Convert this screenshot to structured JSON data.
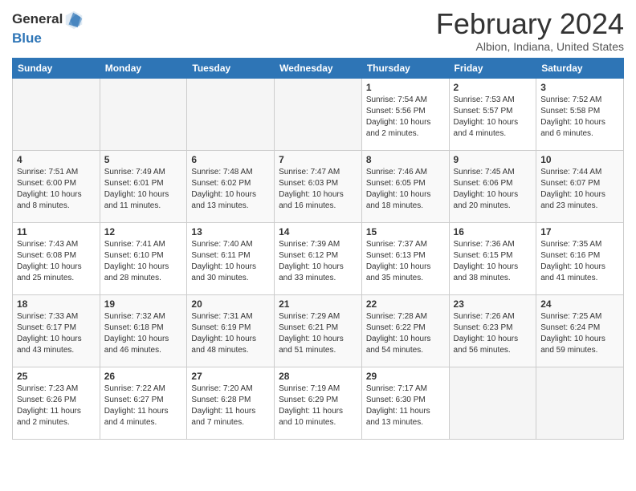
{
  "header": {
    "logo_general": "General",
    "logo_blue": "Blue",
    "title": "February 2024",
    "subtitle": "Albion, Indiana, United States"
  },
  "days_of_week": [
    "Sunday",
    "Monday",
    "Tuesday",
    "Wednesday",
    "Thursday",
    "Friday",
    "Saturday"
  ],
  "weeks": [
    [
      {
        "day": "",
        "info": ""
      },
      {
        "day": "",
        "info": ""
      },
      {
        "day": "",
        "info": ""
      },
      {
        "day": "",
        "info": ""
      },
      {
        "day": "1",
        "info": "Sunrise: 7:54 AM\nSunset: 5:56 PM\nDaylight: 10 hours\nand 2 minutes."
      },
      {
        "day": "2",
        "info": "Sunrise: 7:53 AM\nSunset: 5:57 PM\nDaylight: 10 hours\nand 4 minutes."
      },
      {
        "day": "3",
        "info": "Sunrise: 7:52 AM\nSunset: 5:58 PM\nDaylight: 10 hours\nand 6 minutes."
      }
    ],
    [
      {
        "day": "4",
        "info": "Sunrise: 7:51 AM\nSunset: 6:00 PM\nDaylight: 10 hours\nand 8 minutes."
      },
      {
        "day": "5",
        "info": "Sunrise: 7:49 AM\nSunset: 6:01 PM\nDaylight: 10 hours\nand 11 minutes."
      },
      {
        "day": "6",
        "info": "Sunrise: 7:48 AM\nSunset: 6:02 PM\nDaylight: 10 hours\nand 13 minutes."
      },
      {
        "day": "7",
        "info": "Sunrise: 7:47 AM\nSunset: 6:03 PM\nDaylight: 10 hours\nand 16 minutes."
      },
      {
        "day": "8",
        "info": "Sunrise: 7:46 AM\nSunset: 6:05 PM\nDaylight: 10 hours\nand 18 minutes."
      },
      {
        "day": "9",
        "info": "Sunrise: 7:45 AM\nSunset: 6:06 PM\nDaylight: 10 hours\nand 20 minutes."
      },
      {
        "day": "10",
        "info": "Sunrise: 7:44 AM\nSunset: 6:07 PM\nDaylight: 10 hours\nand 23 minutes."
      }
    ],
    [
      {
        "day": "11",
        "info": "Sunrise: 7:43 AM\nSunset: 6:08 PM\nDaylight: 10 hours\nand 25 minutes."
      },
      {
        "day": "12",
        "info": "Sunrise: 7:41 AM\nSunset: 6:10 PM\nDaylight: 10 hours\nand 28 minutes."
      },
      {
        "day": "13",
        "info": "Sunrise: 7:40 AM\nSunset: 6:11 PM\nDaylight: 10 hours\nand 30 minutes."
      },
      {
        "day": "14",
        "info": "Sunrise: 7:39 AM\nSunset: 6:12 PM\nDaylight: 10 hours\nand 33 minutes."
      },
      {
        "day": "15",
        "info": "Sunrise: 7:37 AM\nSunset: 6:13 PM\nDaylight: 10 hours\nand 35 minutes."
      },
      {
        "day": "16",
        "info": "Sunrise: 7:36 AM\nSunset: 6:15 PM\nDaylight: 10 hours\nand 38 minutes."
      },
      {
        "day": "17",
        "info": "Sunrise: 7:35 AM\nSunset: 6:16 PM\nDaylight: 10 hours\nand 41 minutes."
      }
    ],
    [
      {
        "day": "18",
        "info": "Sunrise: 7:33 AM\nSunset: 6:17 PM\nDaylight: 10 hours\nand 43 minutes."
      },
      {
        "day": "19",
        "info": "Sunrise: 7:32 AM\nSunset: 6:18 PM\nDaylight: 10 hours\nand 46 minutes."
      },
      {
        "day": "20",
        "info": "Sunrise: 7:31 AM\nSunset: 6:19 PM\nDaylight: 10 hours\nand 48 minutes."
      },
      {
        "day": "21",
        "info": "Sunrise: 7:29 AM\nSunset: 6:21 PM\nDaylight: 10 hours\nand 51 minutes."
      },
      {
        "day": "22",
        "info": "Sunrise: 7:28 AM\nSunset: 6:22 PM\nDaylight: 10 hours\nand 54 minutes."
      },
      {
        "day": "23",
        "info": "Sunrise: 7:26 AM\nSunset: 6:23 PM\nDaylight: 10 hours\nand 56 minutes."
      },
      {
        "day": "24",
        "info": "Sunrise: 7:25 AM\nSunset: 6:24 PM\nDaylight: 10 hours\nand 59 minutes."
      }
    ],
    [
      {
        "day": "25",
        "info": "Sunrise: 7:23 AM\nSunset: 6:26 PM\nDaylight: 11 hours\nand 2 minutes."
      },
      {
        "day": "26",
        "info": "Sunrise: 7:22 AM\nSunset: 6:27 PM\nDaylight: 11 hours\nand 4 minutes."
      },
      {
        "day": "27",
        "info": "Sunrise: 7:20 AM\nSunset: 6:28 PM\nDaylight: 11 hours\nand 7 minutes."
      },
      {
        "day": "28",
        "info": "Sunrise: 7:19 AM\nSunset: 6:29 PM\nDaylight: 11 hours\nand 10 minutes."
      },
      {
        "day": "29",
        "info": "Sunrise: 7:17 AM\nSunset: 6:30 PM\nDaylight: 11 hours\nand 13 minutes."
      },
      {
        "day": "",
        "info": ""
      },
      {
        "day": "",
        "info": ""
      }
    ]
  ]
}
